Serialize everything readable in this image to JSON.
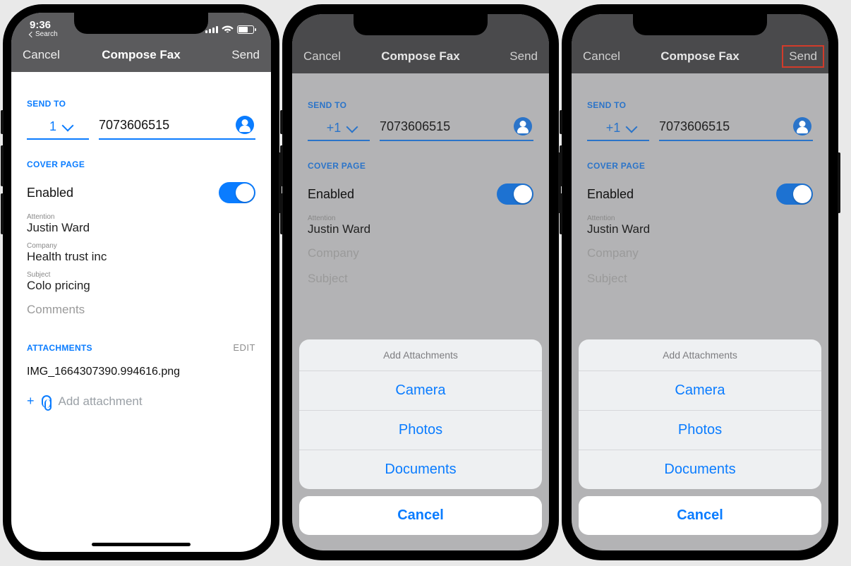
{
  "status": {
    "time": "9:36",
    "back_label": "Search"
  },
  "nav": {
    "cancel": "Cancel",
    "title": "Compose Fax",
    "send": "Send"
  },
  "sections": {
    "send_to": "SEND TO",
    "cover_page": "COVER PAGE",
    "attachments": "ATTACHMENTS"
  },
  "labels": {
    "enabled": "Enabled",
    "attention": "Attention",
    "company": "Company",
    "subject": "Subject",
    "comments": "Comments",
    "edit": "EDIT",
    "add_attachment": "Add attachment"
  },
  "phone_a": {
    "country_code": "1",
    "number": "7073606515",
    "attention": "Justin Ward",
    "company": "Health trust inc",
    "subject": "Colo pricing",
    "attachment_file": "IMG_1664307390.994616.png"
  },
  "phone_b": {
    "country_code": "+1",
    "number": "7073606515",
    "attention": "Justin Ward",
    "company_placeholder": "Company",
    "subject_placeholder": "Subject"
  },
  "phone_c": {
    "country_code": "+1",
    "number": "7073606515",
    "attention": "Justin Ward",
    "company_placeholder": "Company",
    "subject_placeholder": "Subject"
  },
  "sheet": {
    "title": "Add Attachments",
    "items": [
      "Camera",
      "Photos",
      "Documents"
    ],
    "cancel": "Cancel"
  }
}
